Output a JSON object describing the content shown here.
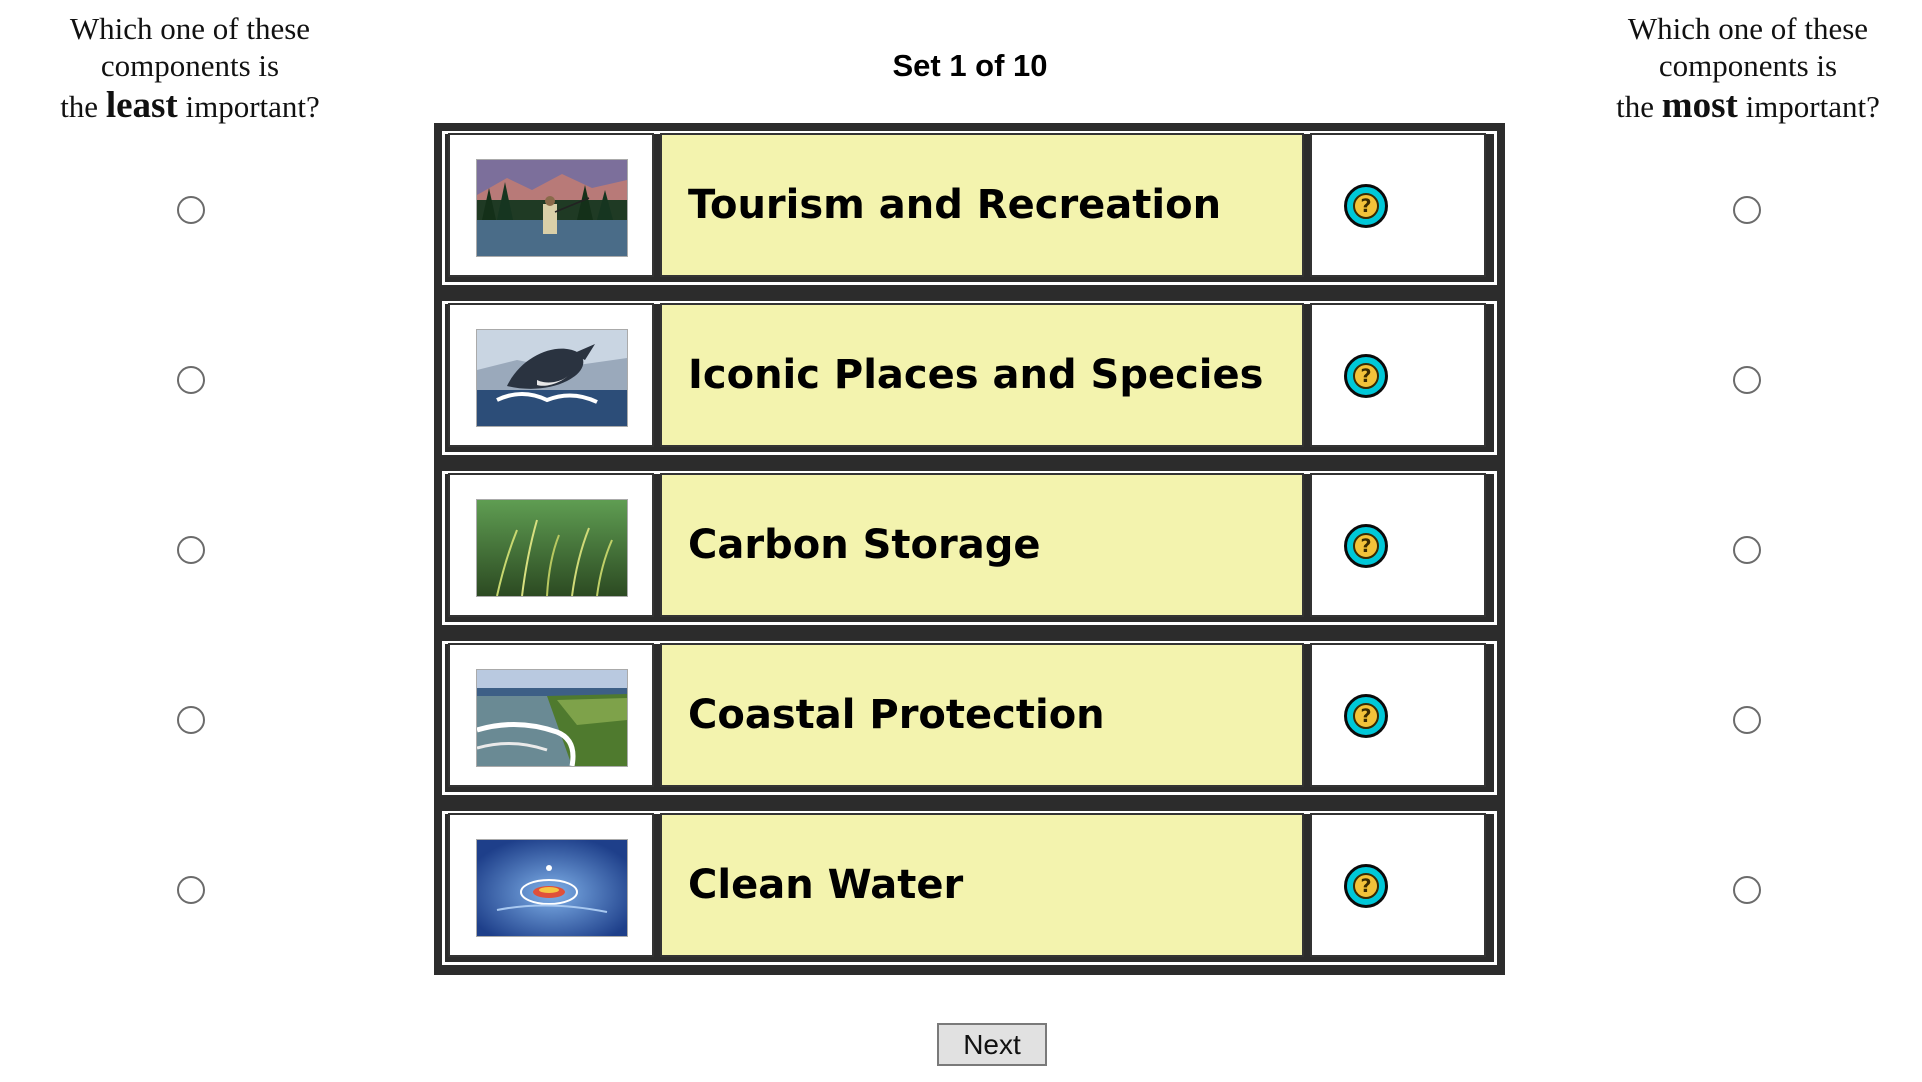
{
  "header": {
    "left": {
      "line1": "Which one of these",
      "line2": "components is",
      "prefix": "the",
      "emphasis": "least",
      "suffix": "important?"
    },
    "right": {
      "line1": "Which one of these",
      "line2": "components is",
      "prefix": "the",
      "emphasis": "most",
      "suffix": "important?"
    },
    "set_label": "Set 1 of 10"
  },
  "rows": [
    {
      "label": "Tourism and Recreation",
      "image": "fly-fishing-mountains-photo",
      "help_icon": "question-mark-icon"
    },
    {
      "label": "Iconic Places and Species",
      "image": "breaching-whale-photo",
      "help_icon": "question-mark-icon"
    },
    {
      "label": "Carbon Storage",
      "image": "seagrass-underwater-photo",
      "help_icon": "question-mark-icon"
    },
    {
      "label": "Coastal Protection",
      "image": "marsh-shoreline-waves-photo",
      "help_icon": "question-mark-icon"
    },
    {
      "label": "Clean Water",
      "image": "water-droplet-splash-photo",
      "help_icon": "question-mark-icon"
    }
  ],
  "help_glyph": "?",
  "next_label": "Next",
  "colors": {
    "label_bg": "#f3f3ae",
    "table_frame": "#2c2c2c",
    "help_icon_ring": "#00c8d8",
    "help_icon_core": "#f2c23a"
  }
}
